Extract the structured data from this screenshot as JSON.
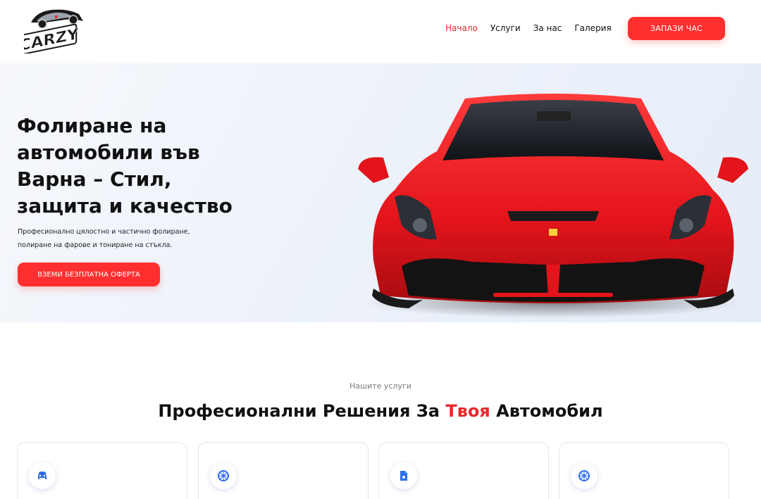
{
  "header": {
    "nav": [
      {
        "label": "Начало"
      },
      {
        "label": "Услуги"
      },
      {
        "label": "За нас"
      },
      {
        "label": "Галерия"
      }
    ],
    "cta_label": "ЗАПАЗИ ЧАС"
  },
  "logo": {
    "text": "CARZY"
  },
  "hero": {
    "title_lines": [
      "Фолиране на",
      "автомобили във",
      "Варна – Стил,",
      "защита и качество"
    ],
    "subtitle_lines": [
      "Професионално цялостно и частично фолиране,",
      "полиране на фарове и тониране на стъкла."
    ],
    "button_label": "ВЗЕМИ БЕЗПЛАТНА ОФЕРТА"
  },
  "services": {
    "eyebrow": "Нашите услуги",
    "title_before": "Професионални Решения За ",
    "title_accent": "Твоя",
    "title_after": " Автомобил",
    "cards": [
      {
        "icon": "car-wrap-icon"
      },
      {
        "icon": "wheel-icon"
      },
      {
        "icon": "document-icon"
      },
      {
        "icon": "wheel-icon"
      }
    ]
  },
  "colors": {
    "accent": "#ff2f2f",
    "text": "#111111"
  }
}
